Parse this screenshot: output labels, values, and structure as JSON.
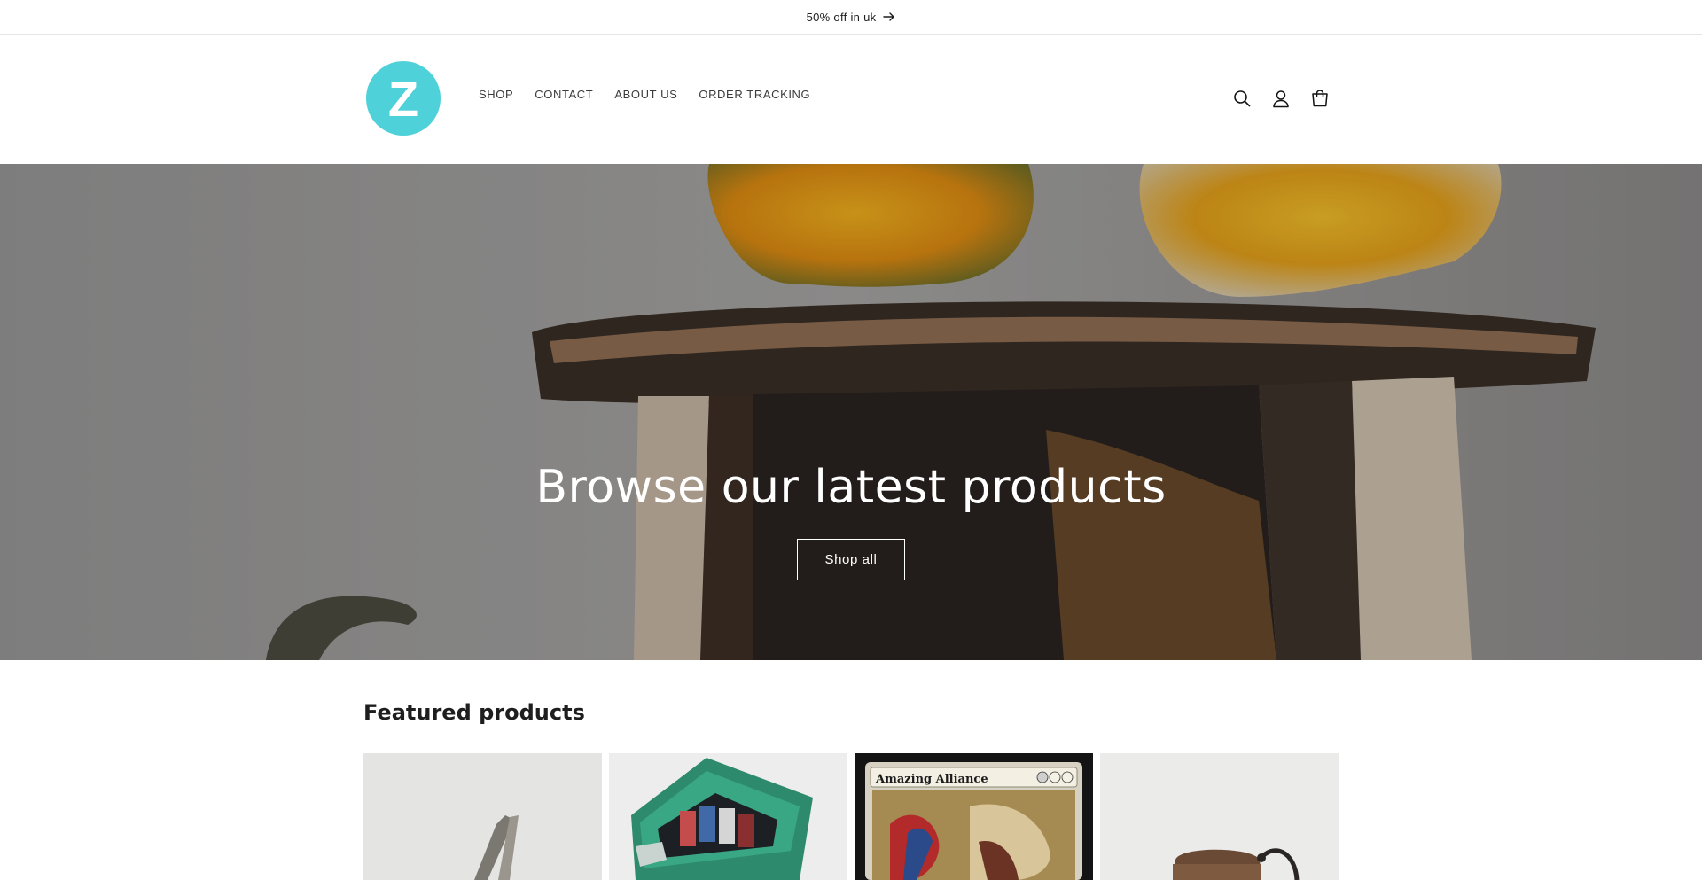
{
  "announcement": {
    "text": "50% off in uk",
    "icon": "arrow-right-icon"
  },
  "header": {
    "logo_letter": "Z",
    "brand_color": "#4fd1d9",
    "nav": [
      {
        "label": "SHOP"
      },
      {
        "label": "CONTACT"
      },
      {
        "label": "ABOUT US"
      },
      {
        "label": "ORDER TRACKING"
      }
    ],
    "icons": [
      "search-icon",
      "account-icon",
      "cart-icon"
    ]
  },
  "hero": {
    "title": "Browse our latest products",
    "button_label": "Shop all"
  },
  "featured": {
    "title": "Featured products",
    "products": [
      {
        "image": "metal-tool-image"
      },
      {
        "image": "trading-card-box-image"
      },
      {
        "image": "amazing-alliance-card-image",
        "card_name": "Amazing Alliance"
      },
      {
        "image": "copper-kettle-image"
      }
    ]
  }
}
